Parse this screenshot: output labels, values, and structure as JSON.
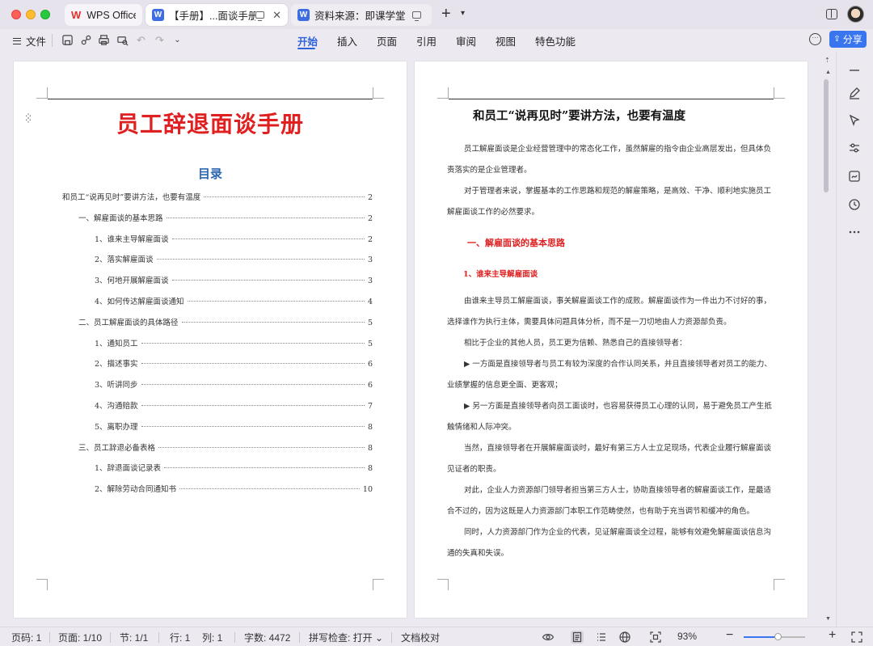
{
  "titlebar": {
    "tabs": [
      {
        "label": "WPS Office"
      },
      {
        "label": "【手册】...面谈手册"
      },
      {
        "label": "资料来源：即课学堂"
      }
    ],
    "app_logo_text": "W"
  },
  "toolbar": {
    "file_label": "文件",
    "ribbon_tabs": [
      "开始",
      "插入",
      "页面",
      "引用",
      "审阅",
      "视图",
      "特色功能"
    ],
    "active_tab": "开始",
    "share_label": "分享",
    "accent_color": "#2e62d9"
  },
  "left_page": {
    "title": "员工辞退面谈手册",
    "toc_heading": "目录",
    "toc": [
      {
        "text": "和员工“说再见时”要讲方法，也要有温度",
        "page": "2",
        "level": 0
      },
      {
        "text": "一、解雇面谈的基本思路",
        "page": "2",
        "level": 1
      },
      {
        "text": "1、谁来主导解雇面谈",
        "page": "2",
        "level": 2
      },
      {
        "text": "2、落实解雇面谈",
        "page": "3",
        "level": 2
      },
      {
        "text": "3、何地开展解雇面谈",
        "page": "3",
        "level": 2
      },
      {
        "text": "4、如何传达解雇面谈通知",
        "page": "4",
        "level": 2
      },
      {
        "text": "二、员工解雇面谈的具体路径",
        "page": "5",
        "level": 1
      },
      {
        "text": "1、通知员工",
        "page": "5",
        "level": 2
      },
      {
        "text": "2、描述事实",
        "page": "6",
        "level": 2
      },
      {
        "text": "3、听讲同步",
        "page": "6",
        "level": 2
      },
      {
        "text": "4、沟通赔款",
        "page": "7",
        "level": 2
      },
      {
        "text": "5、离职办理",
        "page": "8",
        "level": 2
      },
      {
        "text": "三、员工辞退必备表格",
        "page": "8",
        "level": 1
      },
      {
        "text": "1、辞退面谈记录表",
        "page": "8",
        "level": 2
      },
      {
        "text": "2、解除劳动合同通知书",
        "page": "10",
        "level": 2
      }
    ]
  },
  "right_page": {
    "title": "和员工“说再见时”要讲方法，也要有温度",
    "para1": "员工解雇面谈是企业经营管理中的常态化工作，虽然解雇的指令由企业高层发出，但具体负责落实的是企业管理者。",
    "para2": "对于管理者来说，掌握基本的工作思路和规范的解雇策略，是高效、干净、顺利地实施员工解雇面谈工作的必然要求。",
    "h1": "一、解雇面谈的基本思路",
    "h2": "1、谁来主导解雇面谈",
    "para3": "由谁来主导员工解雇面谈，事关解雇面谈工作的成败。解雇面谈作为一件出力不讨好的事，选择谁作为执行主体，需要具体问题具体分析，而不是一刀切地由人力资源部负责。",
    "para4": "相比于企业的其他人员，员工更为信赖、熟悉自己的直接领导者：",
    "para5": "▶ 一方面是直接领导者与员工有较为深度的合作认同关系，并且直接领导者对员工的能力、业绩掌握的信息更全面、更客观；",
    "para6": "▶ 另一方面是直接领导者向员工面谈时，也容易获得员工心理的认同，易于避免员工产生抵触情绪和人际冲突。",
    "para7": "当然，直接领导者在开展解雇面谈时，最好有第三方人士立足现场，代表企业履行解雇面谈见证者的职责。",
    "para8": "对此，企业人力资源部门领导者担当第三方人士，协助直接领导者的解雇面谈工作，是最适合不过的，因为这既是人力资源部门本职工作范畴使然，也有助于充当调节和缓冲的角色。",
    "para9": "同时，人力资源部门作为企业的代表，见证解雇面谈全过程，能够有效避免解雇面谈信息沟通的失真和失误。",
    "heading_color": "#e02020"
  },
  "statusbar": {
    "page_code": "页码: 1",
    "page_count": "页面: 1/10",
    "section": "节: 1/1",
    "row": "行: 1",
    "col": "列: 1",
    "word_count": "字数: 4472",
    "spell_check": "拼写检查: 打开",
    "proofread": "文档校对",
    "zoom": "93%"
  }
}
